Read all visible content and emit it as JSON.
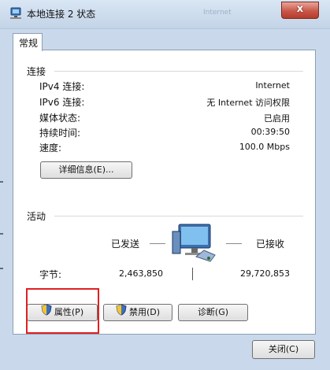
{
  "window": {
    "title": "本地连接 2 状态",
    "close_symbol": "x",
    "background_text": "Internet"
  },
  "tabs": [
    {
      "label": "常规"
    }
  ],
  "connection": {
    "heading": "连接",
    "rows": [
      {
        "label": "IPv4 连接:",
        "value": "Internet"
      },
      {
        "label": "IPv6 连接:",
        "value": "无 Internet 访问权限"
      },
      {
        "label": "媒体状态:",
        "value": "已启用"
      },
      {
        "label": "持续时间:",
        "value": "00:39:50"
      },
      {
        "label": "速度:",
        "value": "100.0 Mbps"
      }
    ],
    "details_button": "详细信息(E)..."
  },
  "activity": {
    "heading": "活动",
    "sent_label": "已发送",
    "received_label": "已接收",
    "bytes_label": "字节:",
    "bytes_sent": "2,463,850",
    "bytes_received": "29,720,853"
  },
  "buttons": {
    "properties": "属性(P)",
    "disable": "禁用(D)",
    "diagnose": "诊断(G)",
    "close": "关闭(C)"
  },
  "colors": {
    "highlight": "#e02020",
    "titlebar": "#c9d8ea",
    "close_button": "#c9574a"
  },
  "icons": [
    "network-icon",
    "shield-icon",
    "computer-network-icon"
  ]
}
